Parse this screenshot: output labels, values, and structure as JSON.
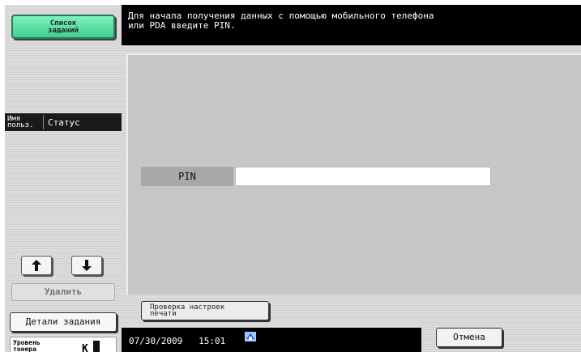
{
  "left_panel": {
    "job_list_label": "Список\nзаданий",
    "column_user": "Имя\nпольз.",
    "column_status": "Статус",
    "up_icon": "arrow-up-icon",
    "down_icon": "arrow-down-icon",
    "delete_label": "Удалить",
    "job_details_label": "Детали задания",
    "toner_label": "Уровень\nтонера",
    "toner_color": "K"
  },
  "header": {
    "message": "Для начала получения данных с помощью мобильного телефона\nили PDA введите PIN."
  },
  "pin": {
    "label": "PIN",
    "value": ""
  },
  "footer": {
    "check_settings_label": "Проверка настроек\nпечати",
    "datetime": "07/30/2009   15:01",
    "network_icon": "network-status-icon",
    "cancel_label": "Отмена"
  }
}
